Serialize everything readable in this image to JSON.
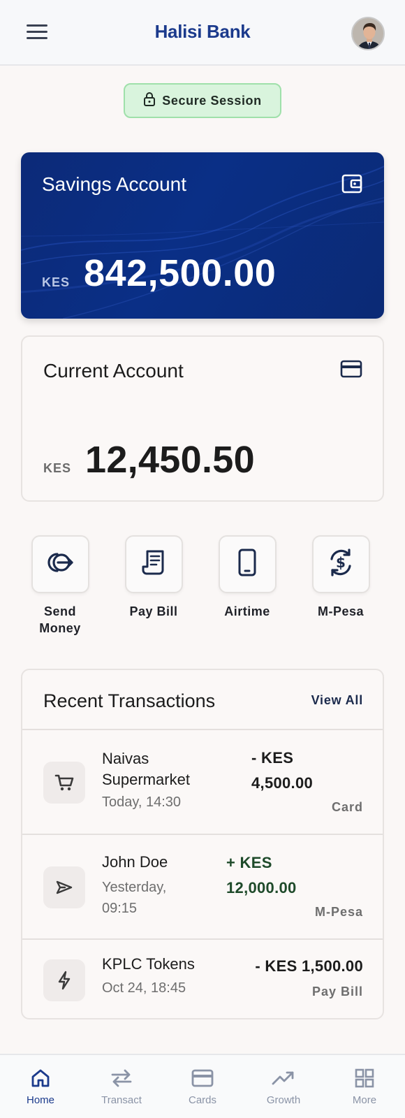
{
  "app": {
    "title": "Halisi Bank"
  },
  "security": {
    "label": "Secure Session"
  },
  "accounts": {
    "savings": {
      "name": "Savings Account",
      "currency": "KES",
      "balance": "842,500.00"
    },
    "current": {
      "name": "Current Account",
      "currency": "KES",
      "balance": "12,450.50"
    }
  },
  "quick_actions": [
    {
      "label": "Send\nMoney",
      "icon": "send-money-icon"
    },
    {
      "label": "Pay Bill",
      "icon": "receipt-icon"
    },
    {
      "label": "Airtime",
      "icon": "phone-icon"
    },
    {
      "label": "M-Pesa",
      "icon": "currency-exchange-icon"
    }
  ],
  "transactions": {
    "title": "Recent Transactions",
    "view_all": "View All",
    "items": [
      {
        "name": "Naivas Supermarket",
        "date": "Today, 14:30",
        "amount": "- KES 4,500.00",
        "method": "Card",
        "icon": "cart-icon",
        "direction": "debit"
      },
      {
        "name": "John Doe",
        "date": "Yesterday, 09:15",
        "amount": "+ KES 12,000.00",
        "method": "M-Pesa",
        "icon": "send-icon",
        "direction": "credit"
      },
      {
        "name": "KPLC Tokens",
        "date": "Oct 24, 18:45",
        "amount": "- KES 1,500.00",
        "method": "Pay Bill",
        "icon": "bolt-icon",
        "direction": "debit"
      }
    ]
  },
  "nav": {
    "items": [
      {
        "label": "Home",
        "icon": "home-icon",
        "active": true
      },
      {
        "label": "Transact",
        "icon": "transfer-icon",
        "active": false
      },
      {
        "label": "Cards",
        "icon": "card-icon",
        "active": false
      },
      {
        "label": "Growth",
        "icon": "trending-up-icon",
        "active": false
      },
      {
        "label": "More",
        "icon": "grid-icon",
        "active": false
      }
    ]
  },
  "colors": {
    "brand": "#1b3a8c",
    "credit": "#1e4a2a",
    "debit": "#1c1c1c",
    "secure_bg": "#d9f4dd"
  }
}
